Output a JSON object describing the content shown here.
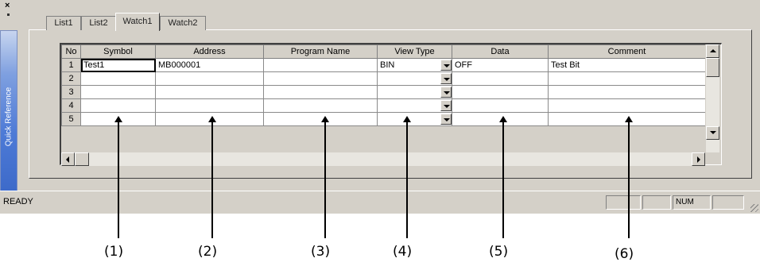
{
  "window": {
    "close_glyph": "×"
  },
  "sidebar": {
    "label": "Quick Reference"
  },
  "tabs": [
    {
      "label": "List1",
      "active": false
    },
    {
      "label": "List2",
      "active": false
    },
    {
      "label": "Watch1",
      "active": true
    },
    {
      "label": "Watch2",
      "active": false
    }
  ],
  "grid": {
    "headers": [
      "No",
      "Symbol",
      "Address",
      "Program Name",
      "View Type",
      "Data",
      "Comment"
    ],
    "rows": [
      {
        "no": "1",
        "symbol": "Test1",
        "address": "MB000001",
        "program": "",
        "view_type": "BIN",
        "data": "OFF",
        "comment": "Test Bit"
      },
      {
        "no": "2",
        "symbol": "",
        "address": "",
        "program": "",
        "view_type": "",
        "data": "",
        "comment": ""
      },
      {
        "no": "3",
        "symbol": "",
        "address": "",
        "program": "",
        "view_type": "",
        "data": "",
        "comment": ""
      },
      {
        "no": "4",
        "symbol": "",
        "address": "",
        "program": "",
        "view_type": "",
        "data": "",
        "comment": ""
      },
      {
        "no": "5",
        "symbol": "",
        "address": "",
        "program": "",
        "view_type": "",
        "data": "",
        "comment": ""
      }
    ]
  },
  "statusbar": {
    "text": "READY",
    "panels": [
      "",
      "",
      "NUM",
      ""
    ]
  },
  "callouts": [
    "(1)",
    "(2)",
    "(3)",
    "(4)",
    "(5)",
    "(6)"
  ],
  "colors": {
    "face": "#d4d0c8",
    "sidebar": "#4d7ad6"
  },
  "icons": [
    "close-icon",
    "pin-icon",
    "dropdown-arrow-icon",
    "scroll-up-icon",
    "scroll-down-icon",
    "scroll-left-icon",
    "scroll-right-icon",
    "size-grip-icon"
  ]
}
